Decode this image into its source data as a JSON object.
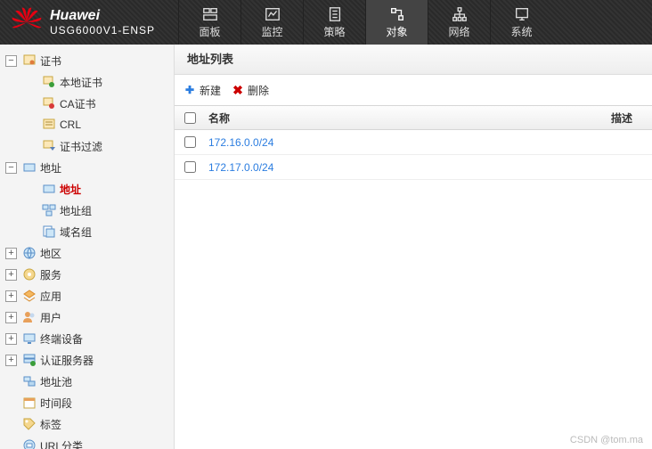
{
  "brand": {
    "name": "Huawei",
    "model": "USG6000V1-ENSP"
  },
  "nav": [
    {
      "label": "面板"
    },
    {
      "label": "监控"
    },
    {
      "label": "策略"
    },
    {
      "label": "对象"
    },
    {
      "label": "网络"
    },
    {
      "label": "系统"
    }
  ],
  "tree": {
    "cert": {
      "label": "证书",
      "children": {
        "local": "本地证书",
        "ca": "CA证书",
        "crl": "CRL",
        "filter": "证书过滤"
      }
    },
    "addr": {
      "label": "地址",
      "children": {
        "address": "地址",
        "group": "地址组",
        "domain": "域名组"
      }
    },
    "region": {
      "label": "地区"
    },
    "service": {
      "label": "服务"
    },
    "app": {
      "label": "应用"
    },
    "user": {
      "label": "用户"
    },
    "terminal": {
      "label": "终端设备"
    },
    "auth": {
      "label": "认证服务器"
    },
    "pool": {
      "label": "地址池"
    },
    "time": {
      "label": "时间段"
    },
    "tag": {
      "label": "标签"
    },
    "url": {
      "label": "URL分类"
    }
  },
  "panel": {
    "title": "地址列表",
    "toolbar": {
      "add": "新建",
      "del": "删除"
    },
    "columns": {
      "name": "名称",
      "desc": "描述"
    },
    "rows": [
      {
        "name": "172.16.0.0/24"
      },
      {
        "name": "172.17.0.0/24"
      }
    ]
  },
  "watermark": "CSDN @tom.ma"
}
